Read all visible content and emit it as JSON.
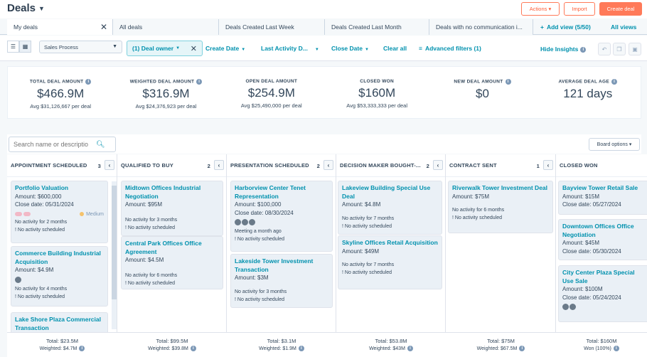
{
  "header": {
    "title": "Deals",
    "actions_label": "Actions ▾",
    "import_label": "Import",
    "create_label": "Create deal"
  },
  "tabs": [
    {
      "label": "My deals"
    },
    {
      "label": "All deals"
    },
    {
      "label": "Deals Created Last Week"
    },
    {
      "label": "Deals Created Last Month"
    },
    {
      "label": "Deals with no communication i..."
    }
  ],
  "add_view_label": "Add view (5/50)",
  "all_views_label": "All views",
  "filters": {
    "process_select": "Sales Process",
    "deal_owner_chip": "(1) Deal owner",
    "create_date": "Create Date",
    "last_activity": "Last Activity D...",
    "close_date": "Close Date",
    "clear_all": "Clear all",
    "advanced": "Advanced filters (1)",
    "hide_insights": "Hide Insights"
  },
  "metrics": [
    {
      "label": "TOTAL DEAL AMOUNT",
      "value": "$466.9M",
      "sub": "Avg $31,126,667 per deal"
    },
    {
      "label": "WEIGHTED DEAL AMOUNT",
      "value": "$316.9M",
      "sub": "Avg $24,376,923 per deal"
    },
    {
      "label": "OPEN DEAL AMOUNT",
      "value": "$254.9M",
      "sub": "Avg $25,490,000 per deal"
    },
    {
      "label": "CLOSED WON",
      "value": "$160M",
      "sub": "Avg $53,333,333 per deal"
    },
    {
      "label": "NEW DEAL AMOUNT",
      "value": "$0",
      "sub": ""
    },
    {
      "label": "AVERAGE DEAL AGE",
      "value": "121 days",
      "sub": ""
    }
  ],
  "board": {
    "search_placeholder": "Search name or descriptio",
    "board_options": "Board options ▾"
  },
  "columns": [
    {
      "title": "APPOINTMENT SCHEDULED",
      "count": "3",
      "cards": [
        {
          "name": "Portfolio Valuation",
          "amount": "$600,000",
          "close": "05/31/2024",
          "priority": "Medium",
          "notes": [
            "No activity for 2 months",
            "! No activity scheduled"
          ]
        },
        {
          "name": "Commerce Building Industrial Acquisition",
          "amount": "$4.9M",
          "notes": [
            "No activity for 4 months",
            "! No activity scheduled"
          ]
        },
        {
          "name": "Lake Shore Plaza Commercial Transaction"
        }
      ],
      "total": "Total: $23.5M",
      "weighted": "Weighted: $4.7M"
    },
    {
      "title": "QUALIFIED TO BUY",
      "count": "2",
      "cards": [
        {
          "name": "Midtown Offices Industrial Negotiation",
          "amount": "$95M",
          "notes": [
            "No activity for 3 months",
            "! No activity scheduled"
          ]
        },
        {
          "name": "Central Park Offices Office Agreement",
          "amount": "$4.5M",
          "notes": [
            "No activity for 6 months",
            "! No activity scheduled"
          ]
        }
      ],
      "total": "Total: $99.5M",
      "weighted": "Weighted: $39.8M"
    },
    {
      "title": "PRESENTATION SCHEDULED",
      "count": "2",
      "cards": [
        {
          "name": "Harborview Center Tenet Representation",
          "amount": "$100,000",
          "close": "08/30/2024",
          "notes": [
            "Meeting a month ago",
            "! No activity scheduled"
          ]
        },
        {
          "name": "Lakeside Tower Investment Transaction",
          "amount": "$3M",
          "notes": [
            "No activity for 3 months",
            "! No activity scheduled"
          ]
        }
      ],
      "total": "Total: $3.1M",
      "weighted": "Weighted: $1.9M"
    },
    {
      "title": "DECISION MAKER BOUGHT-...",
      "count": "2",
      "cards": [
        {
          "name": "Lakeview Building Special Use Deal",
          "amount": "$4.8M",
          "notes": [
            "No activity for 7 months",
            "! No activity scheduled"
          ]
        },
        {
          "name": "Skyline Offices Retail Acquisition",
          "amount": "$49M",
          "notes": [
            "No activity for 7 months",
            "! No activity scheduled"
          ]
        }
      ],
      "total": "Total: $53.8M",
      "weighted": "Weighted: $43M"
    },
    {
      "title": "CONTRACT SENT",
      "count": "1",
      "cards": [
        {
          "name": "Riverwalk Tower Investment Deal",
          "amount": "$75M",
          "notes": [
            "No activity for 6 months",
            "! No activity scheduled"
          ]
        }
      ],
      "total": "Total: $75M",
      "weighted": "Weighted: $67.5M"
    },
    {
      "title": "CLOSED WON",
      "count": "",
      "cards": [
        {
          "name": "Bayview Tower Retail Sale",
          "amount": "$15M",
          "close": "05/27/2024"
        },
        {
          "name": "Downtown Offices Office Negotiation",
          "amount": "$45M",
          "close": "05/30/2024"
        },
        {
          "name": "City Center Plaza Special Use Sale",
          "amount": "$100M",
          "close": "05/24/2024"
        }
      ],
      "total": "Total: $160M",
      "weighted": "Won (100%)"
    }
  ],
  "labels": {
    "amount": "Amount:",
    "close_date": "Close date:"
  }
}
